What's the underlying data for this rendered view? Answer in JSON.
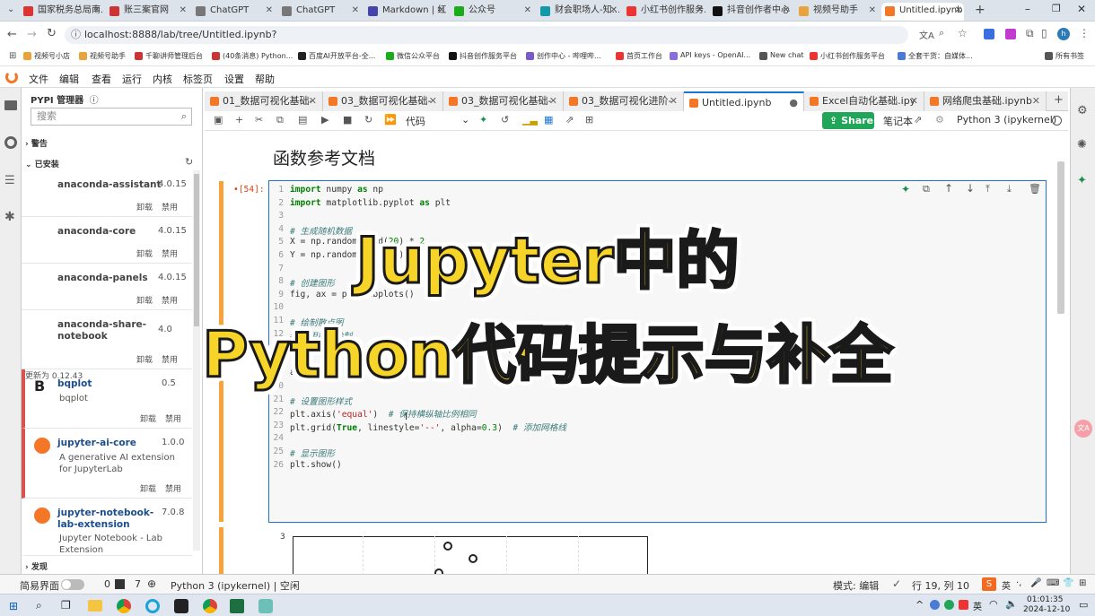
{
  "browser": {
    "tabs": [
      {
        "label": "国家税务总局南...",
        "color": "#d33"
      },
      {
        "label": "账三案官网",
        "color": "#c33"
      },
      {
        "label": "ChatGPT",
        "color": "#777"
      },
      {
        "label": "ChatGPT",
        "color": "#777"
      },
      {
        "label": "Markdown | 红...",
        "color": "#44a"
      },
      {
        "label": "公众号",
        "color": "#1aad19"
      },
      {
        "label": "财会职场人-知...",
        "color": "#19a"
      },
      {
        "label": "小红书创作服务...",
        "color": "#e33"
      },
      {
        "label": "抖音创作者中心",
        "color": "#111"
      },
      {
        "label": "视频号助手",
        "color": "#e8a33c"
      },
      {
        "label": "Untitled.ipynb",
        "color": "#f37726"
      }
    ],
    "url": "localhost:8888/lab/tree/Untitled.ipynb?",
    "bookmarks": [
      "视频号小店",
      "视频号助手",
      "千聊讲师管理后台",
      "(40条消息) Python...",
      "百度AI开放平台-全...",
      "微信公众平台",
      "抖音创作服务平台",
      "创作中心 - 哔哩哔...",
      "首页工作台",
      "API keys - OpenAI...",
      "New chat",
      "小红书创作服务平台",
      "全套干货：自媒体...",
      "所有书签"
    ]
  },
  "jupyter": {
    "menu": [
      "文件",
      "编辑",
      "查看",
      "运行",
      "内核",
      "标签页",
      "设置",
      "帮助"
    ],
    "sidebar": {
      "title": "PYPI 管理器",
      "search_placeholder": "搜索",
      "warning_section": "警告",
      "installed_section": "已安装",
      "discover_section": "发现",
      "uninstall_label": "卸载",
      "disable_label": "禁用",
      "packages": [
        {
          "name": "anaconda-assistant",
          "version": "4.0.15"
        },
        {
          "name": "anaconda-core",
          "version": "4.0.15"
        },
        {
          "name": "anaconda-panels",
          "version": "4.0.15"
        },
        {
          "name": "anaconda-share-notebook",
          "version": "4.0"
        },
        {
          "name": "bqplot",
          "desc": "bqplot",
          "version": "0.5",
          "update": "更新为 0.12.43"
        },
        {
          "name": "jupyter-ai-core",
          "desc": "A generative AI extension for JupyterLab",
          "version": "1.0.0"
        },
        {
          "name": "jupyter-notebook-lab-extension",
          "desc": "Jupyter Notebook - Lab Extension",
          "version": "7.0.8"
        }
      ]
    },
    "tabs": [
      "01_数据可视化基础-",
      "03_数据可视化基础-",
      "03_数据可视化基础-",
      "03_数据可视化进阶-",
      "Untitled.ipynb",
      "Excel自动化基础.ipy",
      "网络爬虫基础.ipynb"
    ],
    "toolbar": {
      "cell_type": "代码",
      "share": "Share",
      "notebook_label": "笔记本",
      "kernel": "Python 3 (ipykernel)"
    },
    "notebook": {
      "heading": "函数参考文档",
      "prompt": "•[54]:",
      "lines": [
        {
          "n": "1",
          "t": "import numpy as np"
        },
        {
          "n": "2",
          "t": "import matplotlib.pyplot as plt"
        },
        {
          "n": "3",
          "t": ""
        },
        {
          "n": "4",
          "t": "# 生成随机数据"
        },
        {
          "n": "5",
          "t": "X = np.random.rand(20) * 2"
        },
        {
          "n": "6",
          "t": "Y = np.random.rand(20) * 2"
        },
        {
          "n": "7",
          "t": ""
        },
        {
          "n": "8",
          "t": "# 创建图形"
        },
        {
          "n": "9",
          "t": "fig, ax = plt.subplots()"
        },
        {
          "n": "10",
          "t": ""
        },
        {
          "n": "11",
          "t": "# 绘制散点图"
        },
        {
          "n": "12",
          "t": "# 使用散点绘制"
        },
        {
          "n": "17",
          "t": "ax.scatter(X, Y, 40, 'C1', lw=2, alpha=0.1)  # 使用橙色(C1)，线宽2，透明度为0.1"
        },
        {
          "n": "18",
          "t": ""
        },
        {
          "n": "19",
          "t": "ax.acorr()"
        },
        {
          "n": "20",
          "t": ""
        },
        {
          "n": "21",
          "t": "# 设置图形样式"
        },
        {
          "n": "22",
          "t": "plt.axis('equal')  # 保持横纵轴比例相同"
        },
        {
          "n": "23",
          "t": "plt.grid(True, linestyle='--', alpha=0.3)  # 添加网格线"
        },
        {
          "n": "24",
          "t": ""
        },
        {
          "n": "25",
          "t": "# 显示图形"
        },
        {
          "n": "26",
          "t": "plt.show()"
        }
      ],
      "plot_ytick": "3"
    },
    "overlay": {
      "line1": "Jupyter中的",
      "line2": "Python代码提示与补全"
    },
    "status": {
      "simple_mode": "简易界面",
      "count1": "0",
      "count2": "7",
      "kernel_status": "Python 3 (ipykernel) | 空闲",
      "mode": "模式: 编辑",
      "cursor": "行 19, 列 10",
      "time": "01:01:35",
      "date": "2024-12-10"
    }
  }
}
